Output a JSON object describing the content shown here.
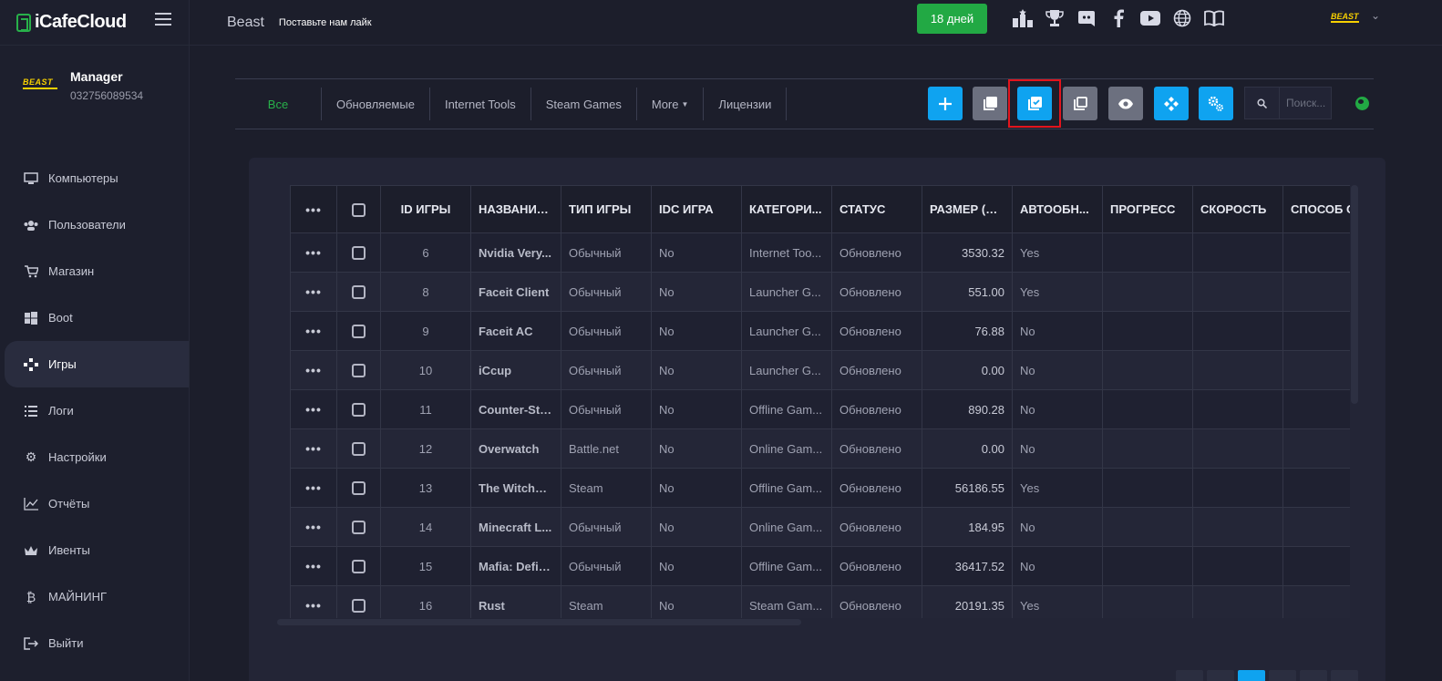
{
  "app": {
    "brand": "iCafeCloud"
  },
  "sidebar": {
    "profile": {
      "logo_text": "BEAST",
      "name": "Manager",
      "phone": "032756089534"
    },
    "items": [
      {
        "label": "Компьютеры",
        "icon": "monitor-icon"
      },
      {
        "label": "Пользователи",
        "icon": "users-icon"
      },
      {
        "label": "Магазин",
        "icon": "cart-icon"
      },
      {
        "label": "Boot",
        "icon": "windows-icon"
      },
      {
        "label": "Игры",
        "icon": "gamepad-icon",
        "active": true
      },
      {
        "label": "Логи",
        "icon": "list-icon"
      },
      {
        "label": "Настройки",
        "icon": "gear-icon"
      },
      {
        "label": "Отчёты",
        "icon": "chart-icon"
      },
      {
        "label": "Ивенты",
        "icon": "crown-icon"
      },
      {
        "label": "МАЙНИНГ",
        "icon": "bitcoin-icon"
      },
      {
        "label": "Выйти",
        "icon": "logout-icon"
      }
    ]
  },
  "header": {
    "title": "Beast",
    "subtitle": "Поставьте нам лайк",
    "days_label": "18 дней",
    "icons": [
      "leaderboard-icon",
      "trophy-icon",
      "discord-icon",
      "facebook-icon",
      "youtube-icon",
      "globe-icon",
      "book-icon"
    ],
    "brand_text": "BEAST"
  },
  "tabs": [
    "Все",
    "Обновляемые",
    "Internet Tools",
    "Steam Games",
    "More",
    "Лицензии"
  ],
  "toolbar": {
    "buttons": [
      {
        "icon": "plus-icon",
        "color": "#0fa3f0"
      },
      {
        "icon": "copy-icon",
        "color": "#6c707f"
      },
      {
        "icon": "copy-check-icon",
        "color": "#0fa3f0",
        "highlighted": true
      },
      {
        "icon": "copy-outline-icon",
        "color": "#6c707f"
      },
      {
        "icon": "eye-icon",
        "color": "#6c707f"
      },
      {
        "icon": "diamond-icon",
        "color": "#0fa3f0"
      },
      {
        "icon": "cogs-icon",
        "color": "#0fa3f0"
      }
    ],
    "search_placeholder": "Поиск..."
  },
  "table": {
    "columns": [
      "•••",
      "",
      "ID ИГРЫ",
      "НАЗВАНИЕ...",
      "ТИП ИГРЫ",
      "IDC ИГРА",
      "КАТЕГОРИ...",
      "СТАТУС",
      "РАЗМЕР (M...",
      "АВТООБН...",
      "ПРОГРЕСС",
      "СКОРОСТЬ",
      "СПОСОБ С"
    ],
    "rows": [
      {
        "id": "6",
        "name": "Nvidia Very...",
        "type": "Обычный",
        "idc": "No",
        "category": "Internet Too...",
        "status": "Обновлено",
        "size": "3530.32",
        "auto": "Yes"
      },
      {
        "id": "8",
        "name": "Faceit Client",
        "type": "Обычный",
        "idc": "No",
        "category": "Launcher G...",
        "status": "Обновлено",
        "size": "551.00",
        "auto": "Yes"
      },
      {
        "id": "9",
        "name": "Faceit AC",
        "type": "Обычный",
        "idc": "No",
        "category": "Launcher G...",
        "status": "Обновлено",
        "size": "76.88",
        "auto": "No"
      },
      {
        "id": "10",
        "name": "iCcup",
        "type": "Обычный",
        "idc": "No",
        "category": "Launcher G...",
        "status": "Обновлено",
        "size": "0.00",
        "auto": "No"
      },
      {
        "id": "11",
        "name": "Counter-Str...",
        "type": "Обычный",
        "idc": "No",
        "category": "Offline Gam...",
        "status": "Обновлено",
        "size": "890.28",
        "auto": "No"
      },
      {
        "id": "12",
        "name": "Overwatch",
        "type": "Battle.net",
        "idc": "No",
        "category": "Online Gam...",
        "status": "Обновлено",
        "size": "0.00",
        "auto": "No"
      },
      {
        "id": "13",
        "name": "The Witcher...",
        "type": "Steam",
        "idc": "No",
        "category": "Offline Gam...",
        "status": "Обновлено",
        "size": "56186.55",
        "auto": "Yes"
      },
      {
        "id": "14",
        "name": "Minecraft L...",
        "type": "Обычный",
        "idc": "No",
        "category": "Online Gam...",
        "status": "Обновлено",
        "size": "184.95",
        "auto": "No"
      },
      {
        "id": "15",
        "name": "Mafia: Defin...",
        "type": "Обычный",
        "idc": "No",
        "category": "Offline Gam...",
        "status": "Обновлено",
        "size": "36417.52",
        "auto": "No"
      },
      {
        "id": "16",
        "name": "Rust",
        "type": "Steam",
        "idc": "No",
        "category": "Steam Gam...",
        "status": "Обновлено",
        "size": "20191.35",
        "auto": "Yes"
      }
    ]
  }
}
